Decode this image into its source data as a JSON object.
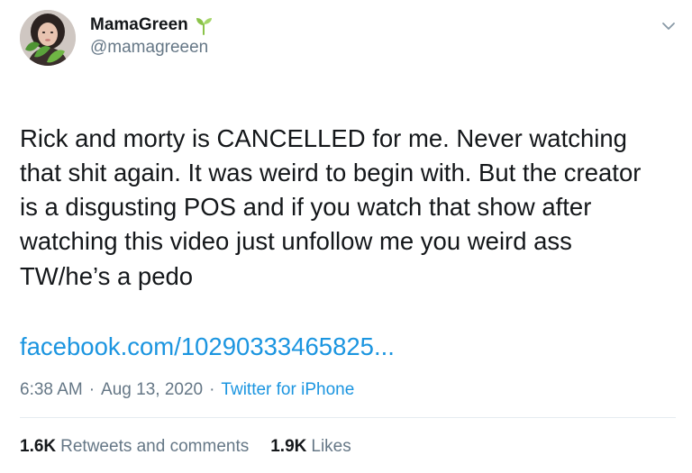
{
  "author": {
    "display_name": "MamaGreen",
    "handle": "@mamagreeen",
    "badge_icon": "sprout-icon",
    "avatar_icon": "profile-photo-avatar"
  },
  "menu_icon": "chevron-down-icon",
  "tweet": {
    "text_lines": "Rick and morty is CANCELLED for me. Never watching\nthat shit again. It was weird to begin with. But the creator\nis a disgusting POS and if you watch that show after\nwatching this video just unfollow me you weird ass",
    "tw_line": "TW/he’s a pedo",
    "link": "facebook.com/10290333465825...",
    "time": "6:38 AM",
    "separator1": "·",
    "date": "Aug 13, 2020",
    "separator2": "·",
    "source": "Twitter for iPhone"
  },
  "stats": {
    "retweets_count": "1.6K",
    "retweets_label": "Retweets and comments",
    "likes_count": "1.9K",
    "likes_label": "Likes"
  },
  "colors": {
    "text": "#14171a",
    "secondary": "#657786",
    "link": "#1b95e0",
    "divider": "#e6ecf0",
    "sprout": "#8bc34a"
  }
}
